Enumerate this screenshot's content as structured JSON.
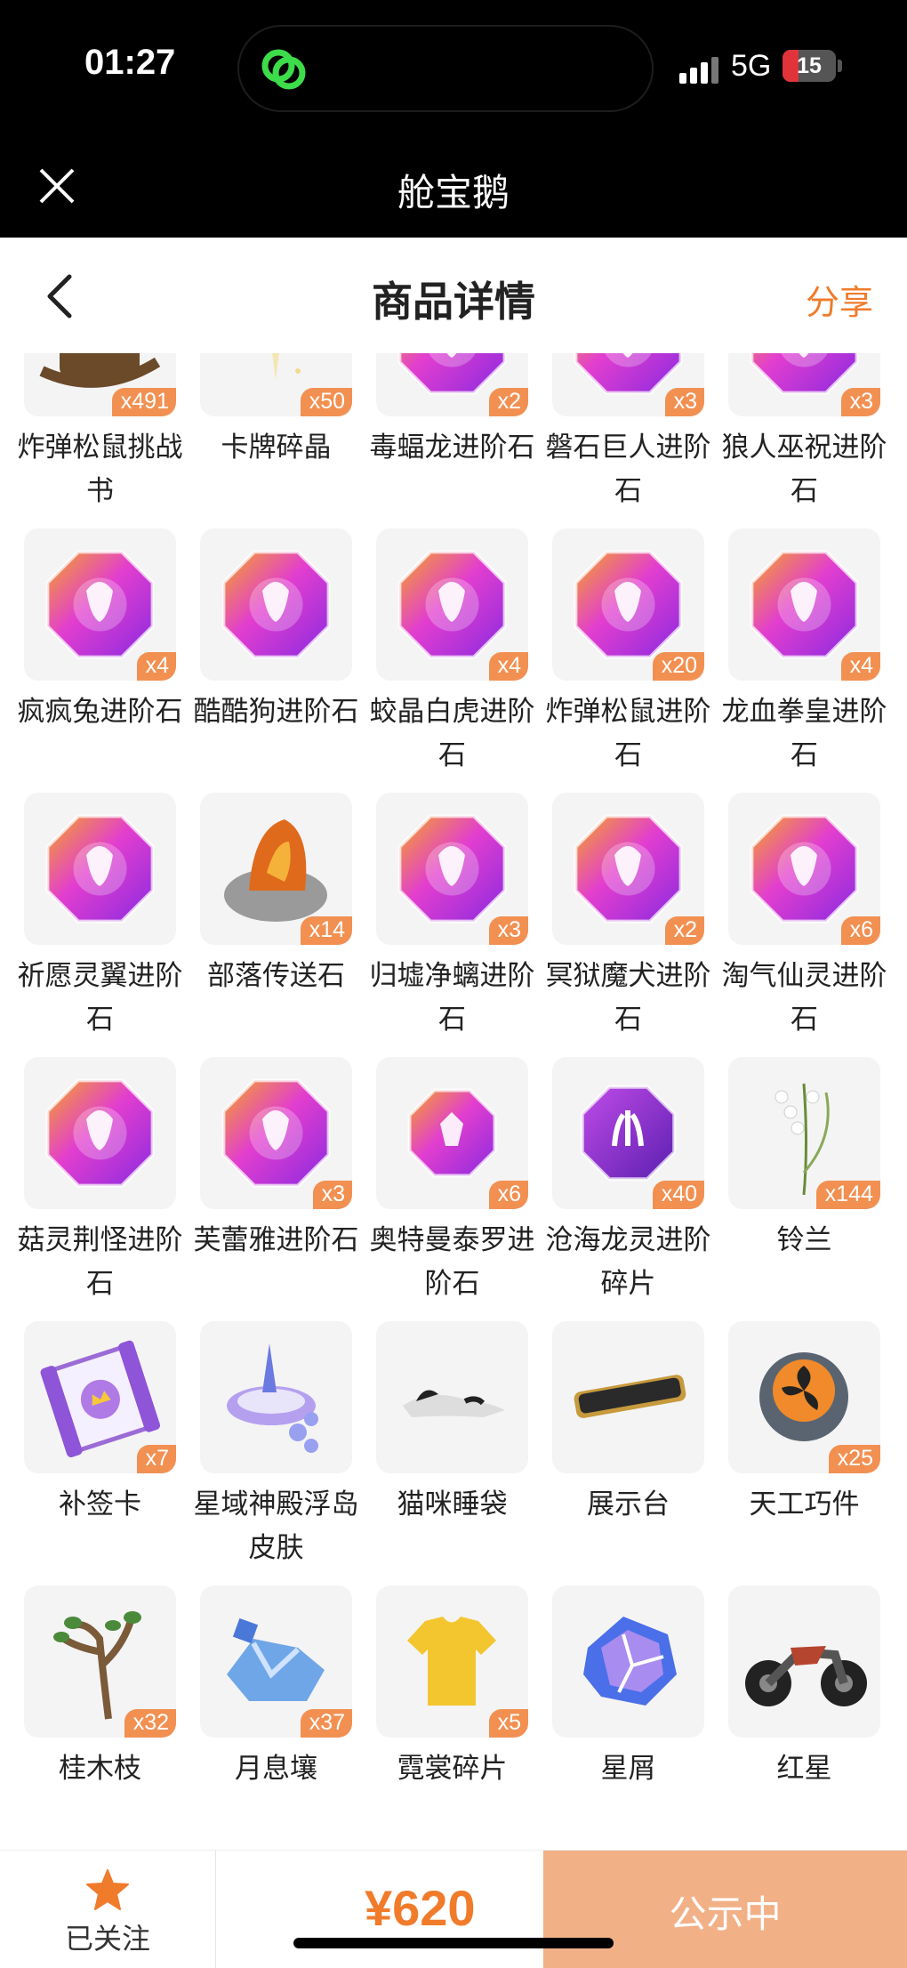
{
  "status": {
    "time": "01:27",
    "network": "5G",
    "battery": "15"
  },
  "app": {
    "title": "舱宝鹅"
  },
  "header": {
    "title": "商品详情",
    "share": "分享"
  },
  "items": [
    {
      "name": "炸弹松鼠挑战书",
      "count": "x491",
      "art": "book"
    },
    {
      "name": "卡牌碎晶",
      "count": "x50",
      "art": "sparkle"
    },
    {
      "name": "毒蝠龙进阶石",
      "count": "x2",
      "art": "gem"
    },
    {
      "name": "磐石巨人进阶石",
      "count": "x3",
      "art": "gem"
    },
    {
      "name": "狼人巫祝进阶石",
      "count": "x3",
      "art": "gem"
    },
    {
      "name": "疯疯兔进阶石",
      "count": "x4",
      "art": "gem"
    },
    {
      "name": "酷酷狗进阶石",
      "count": "",
      "art": "gem"
    },
    {
      "name": "蛟晶白虎进阶石",
      "count": "x4",
      "art": "gem"
    },
    {
      "name": "炸弹松鼠进阶石",
      "count": "x20",
      "art": "gem"
    },
    {
      "name": "龙血拳皇进阶石",
      "count": "x4",
      "art": "gem"
    },
    {
      "name": "祈愿灵翼进阶石",
      "count": "",
      "art": "gem"
    },
    {
      "name": "部落传送石",
      "count": "x14",
      "art": "stone"
    },
    {
      "name": "归墟净螭进阶石",
      "count": "x3",
      "art": "gem"
    },
    {
      "name": "冥狱魔犬进阶石",
      "count": "x2",
      "art": "gem"
    },
    {
      "name": "淘气仙灵进阶石",
      "count": "x6",
      "art": "gem"
    },
    {
      "name": "菇灵荆怪进阶石",
      "count": "",
      "art": "gem"
    },
    {
      "name": "芙蕾雅进阶石",
      "count": "x3",
      "art": "gem"
    },
    {
      "name": "奥特曼泰罗进阶石",
      "count": "x6",
      "art": "gemsmall"
    },
    {
      "name": "沧海龙灵进阶碎片",
      "count": "x40",
      "art": "gempurple"
    },
    {
      "name": "铃兰",
      "count": "x144",
      "art": "flower"
    },
    {
      "name": "补签卡",
      "count": "x7",
      "art": "card"
    },
    {
      "name": "星域神殿浮岛皮肤",
      "count": "",
      "art": "island"
    },
    {
      "name": "猫咪睡袋",
      "count": "",
      "art": "cat"
    },
    {
      "name": "展示台",
      "count": "",
      "art": "stand"
    },
    {
      "name": "天工巧件",
      "count": "x25",
      "art": "gear"
    },
    {
      "name": "桂木枝",
      "count": "x32",
      "art": "branch"
    },
    {
      "name": "月息壤",
      "count": "x37",
      "art": "soil"
    },
    {
      "name": "霓裳碎片",
      "count": "x5",
      "art": "shirt"
    },
    {
      "name": "星屑",
      "count": "",
      "art": "shard"
    },
    {
      "name": "红星",
      "count": "",
      "art": "bike"
    }
  ],
  "bottom": {
    "follow_label": "已关注",
    "price": "¥620",
    "action": "公示中"
  },
  "colors": {
    "accent": "#f07b2b",
    "badge": "#f29052",
    "cta": "#f2b087"
  }
}
